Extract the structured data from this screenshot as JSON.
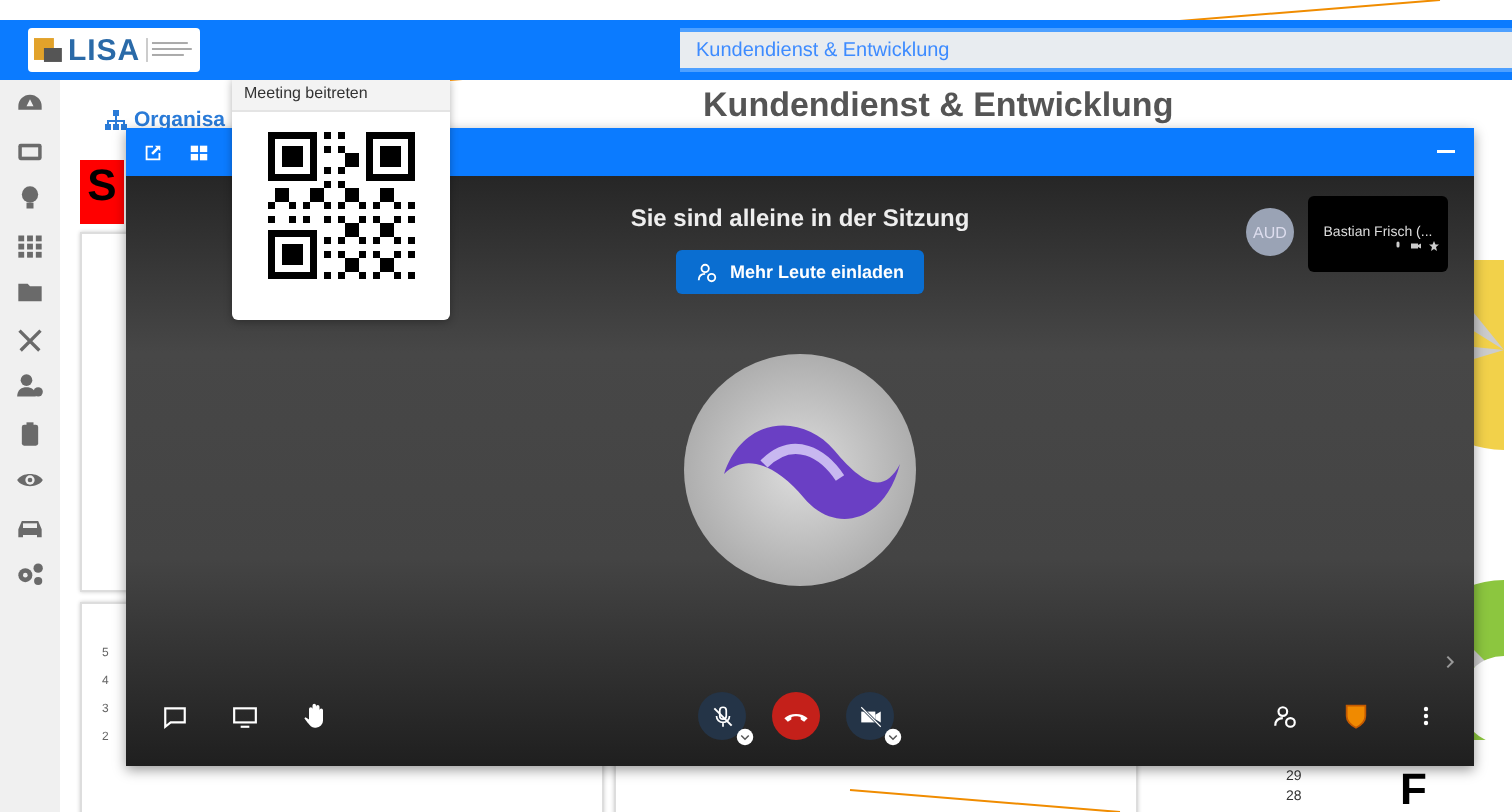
{
  "header": {
    "logo": "LISA",
    "breadcrumb": "Kundendienst & Entwicklung"
  },
  "page": {
    "link": "Organisa",
    "heading": "Kundendienst & Entwicklung",
    "status_tile": "S",
    "axis_labels": [
      "5",
      "4",
      "3",
      "2"
    ],
    "chart_labels": [
      "29",
      "28"
    ],
    "big_letter": "F"
  },
  "meeting": {
    "popup_title": "Meeting beitreten",
    "notice": "Sie sind alleine in der Sitzung",
    "invite_button": "Mehr Leute einladen",
    "avatar": "AUD",
    "participant": "Bastian Frisch (...",
    "mic_muted": true,
    "camera_off": true
  }
}
